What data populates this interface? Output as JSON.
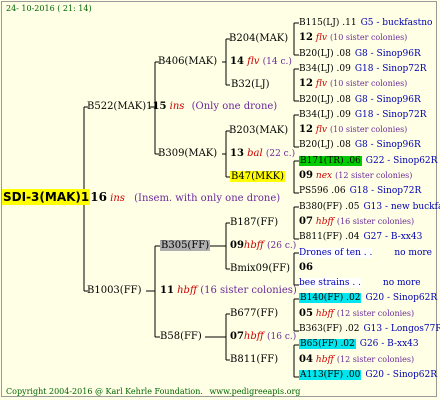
{
  "header": {
    "date": "24- 10-2016 ( 21: 14)"
  },
  "root": {
    "label": "SDI-3(MAK)1",
    "num": "16",
    "race": "ins",
    "note": "(Insem. with only one drone)"
  },
  "gen1": [
    {
      "label": "B522(MAK)1",
      "num": "15",
      "race": "ins",
      "note": "(Only one drone)"
    },
    {
      "label": "B1003(FF)",
      "num": "11",
      "race": "hbff",
      "note": "(16 sister colonies)"
    }
  ],
  "gen2": [
    {
      "label": "B406(MAK)",
      "num": "14",
      "race": "flv",
      "note": "(14 c.)"
    },
    {
      "label": "B309(MAK)",
      "num": "13",
      "race": "bal",
      "note": "(22 c.)"
    },
    {
      "label": "B305(FF)",
      "num": "09",
      "race": "hbff",
      "note": "(26 c.)"
    },
    {
      "label": "B58(FF)",
      "num": "07",
      "race": "hbff",
      "note": "(16 c.)"
    }
  ],
  "gen3": [
    {
      "label": "B204(MAK)"
    },
    {
      "label": "B32(LJ)"
    },
    {
      "label": "B203(MAK)"
    },
    {
      "label": "B47(MKK)"
    },
    {
      "label": "B187(FF)"
    },
    {
      "label": "Bmix09(FF)"
    },
    {
      "label": "B677(FF)"
    },
    {
      "label": "B811(FF)"
    }
  ],
  "gen4": [
    {
      "label": "B115(LJ) .11",
      "info": "G5 - buckfastno"
    },
    {
      "num": "12",
      "race": "flv",
      "note": "(10 sister colonies)"
    },
    {
      "label": "B20(LJ) .08",
      "info": "G8 - Sinop96R"
    },
    {
      "label": "B34(LJ) .09",
      "info": "G18 - Sinop72R"
    },
    {
      "num": "12",
      "race": "flv",
      "note": "(10 sister colonies)"
    },
    {
      "label": "B20(LJ) .08",
      "info": "G8 - Sinop96R"
    },
    {
      "label": "B34(LJ) .09",
      "info": "G18 - Sinop72R"
    },
    {
      "num": "12",
      "race": "flv",
      "note": "(10 sister colonies)"
    },
    {
      "label": "B20(LJ) .08",
      "info": "G8 - Sinop96R"
    },
    {
      "label": "B171(TR) .06",
      "info": "G22 - Sinop62R"
    },
    {
      "num": "09",
      "race": "nex",
      "note": "(12 sister colonies)"
    },
    {
      "label": "PS596 .06",
      "info": "G18 - Sinop72R"
    },
    {
      "label": "B380(FF) .05",
      "info": "G13 - new buckfas"
    },
    {
      "num": "07",
      "race": "hbff",
      "note": "(16 sister colonies)"
    },
    {
      "label": "B811(FF) .04",
      "info": "G27 - B-xx43"
    },
    {
      "label": "Drones of ten . .",
      "info": "no more"
    },
    {
      "num": "06",
      "race": "",
      "note": ""
    },
    {
      "label": "bee strains . .",
      "info": "no more"
    },
    {
      "label": "B140(FF) .02",
      "info": "G20 - Sinop62R"
    },
    {
      "num": "05",
      "race": "hbff",
      "note": "(12 sister colonies)"
    },
    {
      "label": "B363(FF) .02",
      "info": "G13 - Longos77R"
    },
    {
      "label": "B65(FF) .02",
      "info": "G26 - B-xx43"
    },
    {
      "num": "04",
      "race": "hbff",
      "note": "(12 sister colonies)"
    },
    {
      "label": "A113(FF) .00",
      "info": "G20 - Sinop62R"
    }
  ],
  "footer": {
    "copyright": "Copyright 2004-2016 @ Karl Kehrle Foundation.",
    "site": "www.pedigreeapis.org"
  },
  "colors": {
    "green": "#00cc00",
    "cyan": "#00e5ee",
    "yellow": "#ffff00",
    "gray": "#b0b0b0",
    "background": "#ffffe6"
  }
}
